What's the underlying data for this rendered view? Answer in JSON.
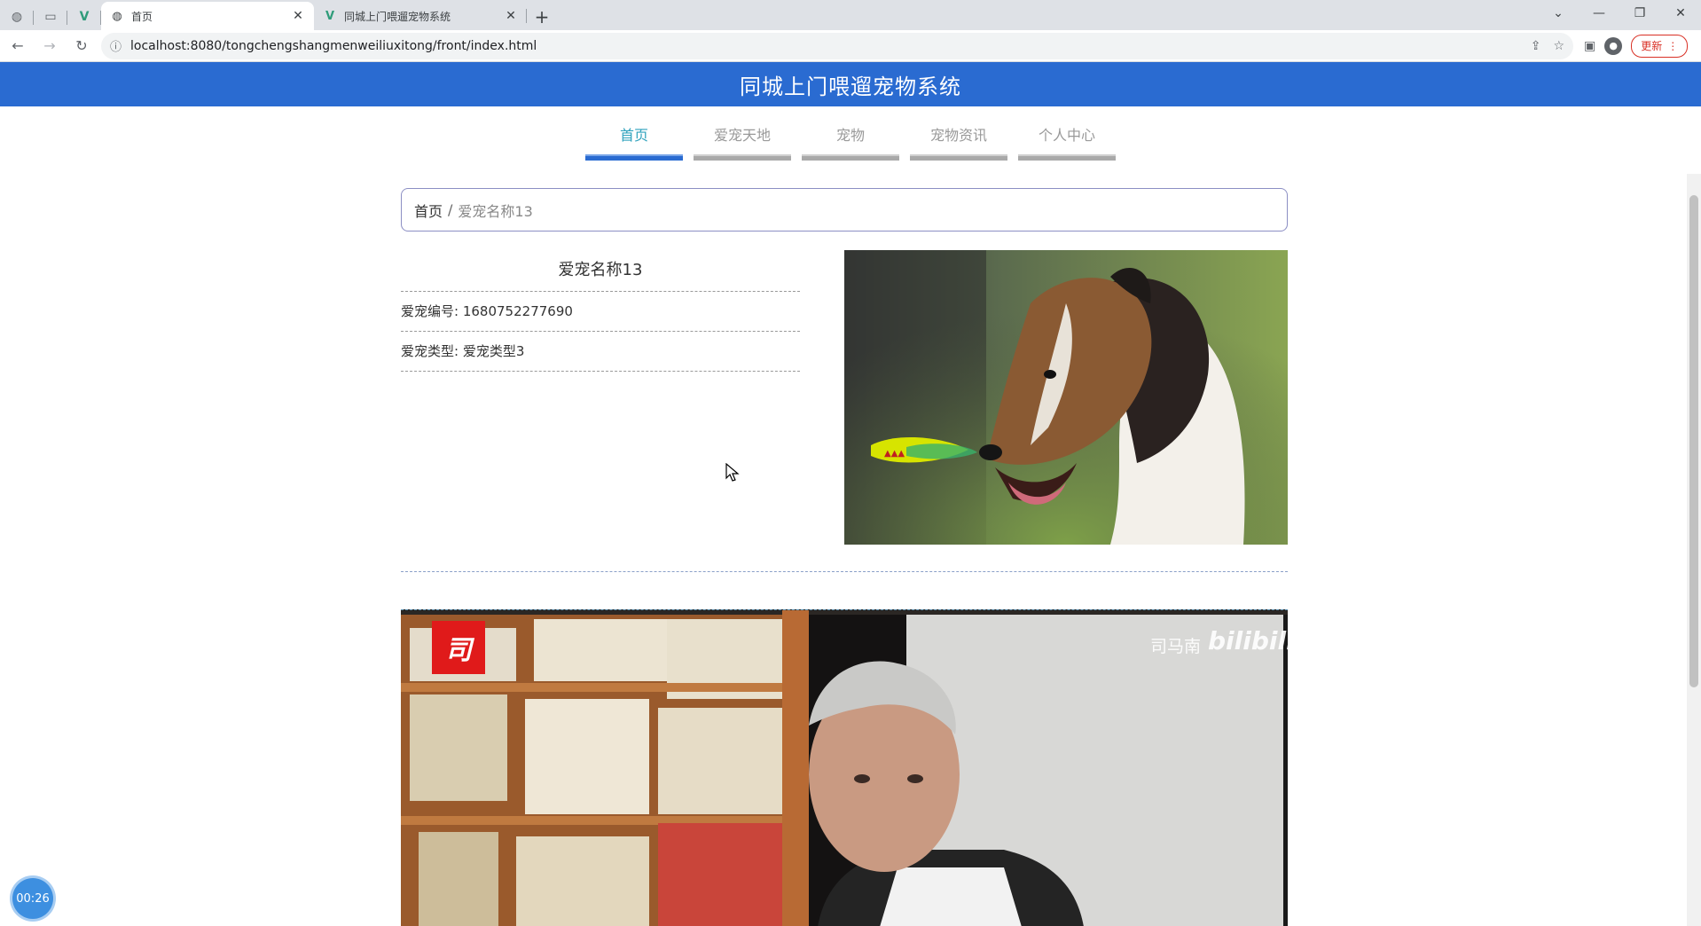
{
  "browser": {
    "tabs": [
      {
        "title": "首页",
        "active": true
      },
      {
        "title": "同城上门喂遛宠物系统",
        "active": false
      }
    ],
    "url": "localhost:8080/tongchengshangmenweiliuxitong/front/index.html",
    "update_label": "更新"
  },
  "site": {
    "title": "同城上门喂遛宠物系统",
    "nav": [
      "首页",
      "爱宠天地",
      "宠物",
      "宠物资讯",
      "个人中心"
    ],
    "active_nav": 0
  },
  "breadcrumb": {
    "home": "首页",
    "separator": "/",
    "current": "爱宠名称13"
  },
  "pet": {
    "name": "爱宠名称13",
    "number_label": "爱宠编号:",
    "number": "1680752277690",
    "type_label": "爱宠类型:",
    "type": "爱宠类型3"
  },
  "video": {
    "logo_char": "司",
    "watermark_name": "司马南",
    "watermark_brand": "bilibili"
  },
  "timer": "00:26",
  "colors": {
    "header_blue": "#2a6bd1",
    "nav_active_text": "#2fa2bd"
  }
}
